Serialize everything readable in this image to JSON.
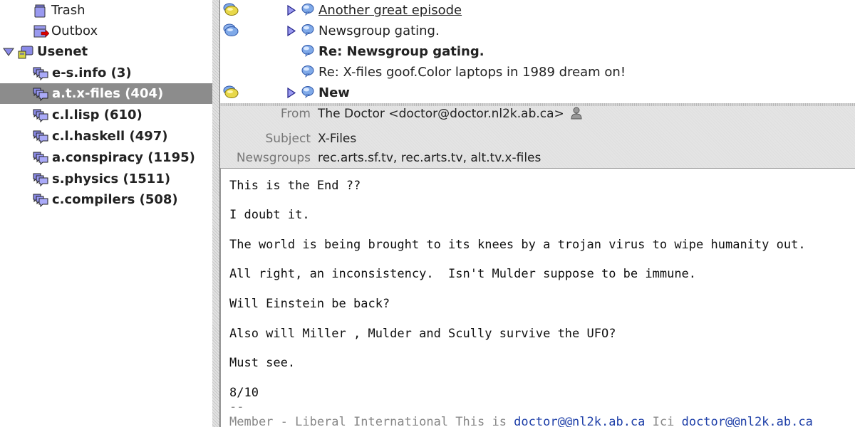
{
  "folder_tree": {
    "items": [
      {
        "label": "Trash",
        "icon": "trash-icon",
        "bold": false,
        "selected": false,
        "indent": 1
      },
      {
        "label": "Outbox",
        "icon": "outbox-icon",
        "bold": false,
        "selected": false,
        "indent": 1
      },
      {
        "label": "Usenet",
        "icon": "news-server-icon",
        "bold": true,
        "selected": false,
        "indent": 0,
        "expanded": true
      },
      {
        "label": "e-s.info (3)",
        "icon": "newsgroup-icon",
        "bold": true,
        "selected": false,
        "indent": 1
      },
      {
        "label": "a.t.x-files (404)",
        "icon": "newsgroup-icon",
        "bold": true,
        "selected": true,
        "indent": 1
      },
      {
        "label": "c.l.lisp (610)",
        "icon": "newsgroup-icon",
        "bold": true,
        "selected": false,
        "indent": 1
      },
      {
        "label": "c.l.haskell (497)",
        "icon": "newsgroup-icon",
        "bold": true,
        "selected": false,
        "indent": 1
      },
      {
        "label": "a.conspiracy (1195)",
        "icon": "newsgroup-icon",
        "bold": true,
        "selected": false,
        "indent": 1
      },
      {
        "label": "s.physics (1511)",
        "icon": "newsgroup-icon",
        "bold": true,
        "selected": false,
        "indent": 1
      },
      {
        "label": "c.compilers (508)",
        "icon": "newsgroup-icon",
        "bold": true,
        "selected": false,
        "indent": 1
      }
    ]
  },
  "message_list": {
    "rows": [
      {
        "subject": "Another great episode",
        "thread_icon": "thread-unread-icon",
        "expander": true,
        "bold": false,
        "underline": true,
        "indent": 0
      },
      {
        "subject": "Newsgroup gating.",
        "thread_icon": "thread-read-icon",
        "expander": true,
        "bold": false,
        "underline": false,
        "indent": 0
      },
      {
        "subject": "Re: Newsgroup gating.",
        "thread_icon": null,
        "expander": false,
        "bold": true,
        "underline": false,
        "indent": 1
      },
      {
        "subject": "Re: X-files goof.Color laptops in 1989 dream on!",
        "thread_icon": null,
        "expander": false,
        "bold": false,
        "underline": false,
        "indent": 1
      },
      {
        "subject": "New",
        "thread_icon": "thread-unread-icon",
        "expander": true,
        "bold": true,
        "underline": false,
        "indent": 0
      }
    ]
  },
  "message_headers": {
    "from_label": "From",
    "from_value": "The Doctor <doctor@doctor.nl2k.ab.ca>",
    "subject_label": "Subject",
    "subject_value": "X-Files",
    "newsgroups_label": "Newsgroups",
    "newsgroups_value": "rec.arts.sf.tv, rec.arts.tv, alt.tv.x-files"
  },
  "message_body": {
    "lines": [
      "This is the End ??",
      "I doubt it.",
      "The world is being brought to its knees by a trojan virus to wipe humanity out.",
      "All right, an inconsistency.  Isn't Mulder suppose to be immune.",
      "Will Einstein be back?",
      "Also will Miller , Mulder and Scully survive the UFO?",
      "Must see.",
      "8/10"
    ],
    "sig_separator": "--",
    "signature": {
      "text1": "Member - Liberal International This is ",
      "link1": "doctor@@nl2k.ab.ca",
      "text2": " Ici ",
      "link2": "doctor@@nl2k.ab.ca"
    }
  }
}
